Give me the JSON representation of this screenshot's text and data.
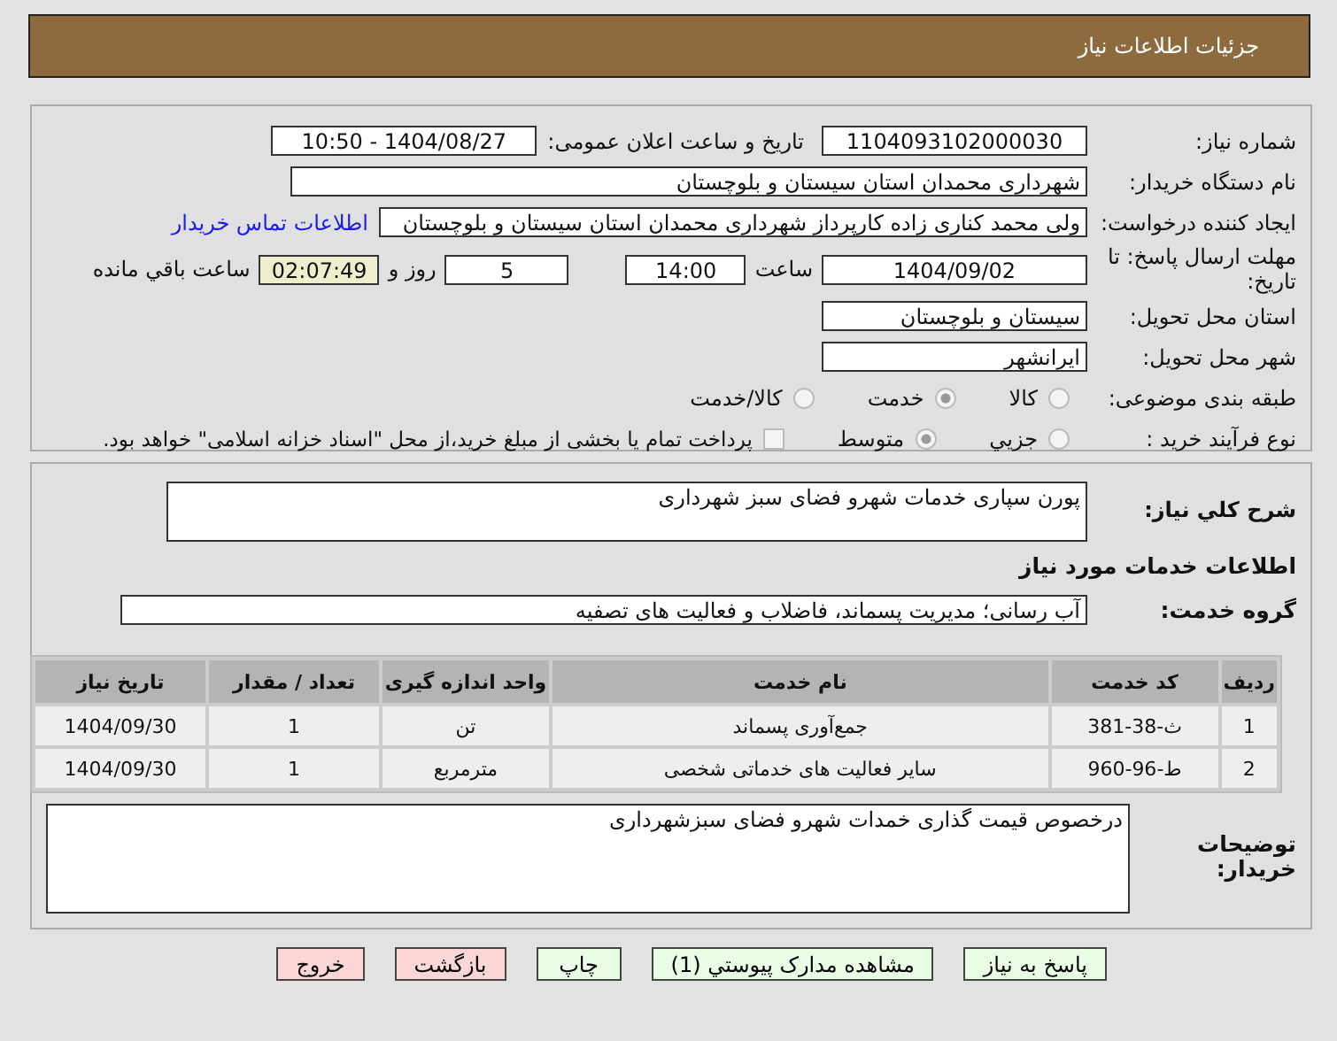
{
  "header": {
    "title": "جزئیات اطلاعات نیاز"
  },
  "need_number": {
    "label": "شماره نیاز:",
    "value": "1104093102000030"
  },
  "announce": {
    "label": "تاریخ و ساعت اعلان عمومی:",
    "value": "1404/08/27 - 10:50"
  },
  "buyer": {
    "label": "نام دستگاه خریدار:",
    "value": "شهرداری محمدان استان سیستان و بلوچستان"
  },
  "creator": {
    "label": "ایجاد کننده درخواست:",
    "value": "ولی محمد کناری زاده کارپرداز شهرداری محمدان استان سیستان و بلوچستان",
    "link": "اطلاعات تماس خریدار"
  },
  "deadline": {
    "label": "مهلت ارسال پاسخ: تا تاریخ:",
    "date": "1404/09/02",
    "time_label": "ساعت",
    "time": "14:00",
    "days": "5",
    "days_label": "روز و",
    "remaining": "02:07:49",
    "remaining_label": "ساعت باقي مانده"
  },
  "province": {
    "label": "استان محل تحویل:",
    "value": "سیستان و بلوچستان"
  },
  "city": {
    "label": "شهر محل تحویل:",
    "value": "ایرانشهر"
  },
  "category": {
    "label": "طبقه بندی موضوعی:",
    "options": [
      {
        "label": "کالا",
        "selected": false
      },
      {
        "label": "خدمت",
        "selected": true
      },
      {
        "label": "کالا/خدمت",
        "selected": false
      }
    ]
  },
  "process": {
    "label": "نوع فرآیند خرید :",
    "options": [
      {
        "label": "جزيي",
        "selected": false
      },
      {
        "label": "متوسط",
        "selected": true
      }
    ],
    "payment": {
      "checked": false,
      "text": "پرداخت تمام یا بخشی از مبلغ خرید،از محل \"اسناد خزانه اسلامی\" خواهد بود."
    }
  },
  "description": {
    "label": "شرح كلي نياز:",
    "value": "پورن سپاری خدمات شهرو فضای سبز شهرداری"
  },
  "services_title": "اطلاعات خدمات مورد نياز",
  "service_group": {
    "label": "گروه خدمت:",
    "value": "آب رسانی؛ مدیریت پسماند، فاضلاب و فعالیت های تصفیه"
  },
  "table": {
    "columns": [
      "ردیف",
      "کد خدمت",
      "نام خدمت",
      "واحد اندازه گیری",
      "تعداد / مقدار",
      "تاریخ نیاز"
    ],
    "rows": [
      [
        "1",
        "ث-38-381",
        "جمع‌آوری پسماند",
        "تن",
        "1",
        "1404/09/30"
      ],
      [
        "2",
        "ط-96-960",
        "سایر فعالیت های خدماتی شخصی",
        "مترمربع",
        "1",
        "1404/09/30"
      ]
    ]
  },
  "notes": {
    "label": "توضیحات خریدار:",
    "value": "درخصوص قیمت گذاری خمدات شهرو فضای سبزشهرداری"
  },
  "buttons": [
    {
      "label": "پاسخ به نیاز",
      "kind": "green"
    },
    {
      "label": "مشاهده مدارک پیوستي (1)",
      "kind": "green"
    },
    {
      "label": "چاپ",
      "kind": "green"
    },
    {
      "label": "بازگشت",
      "kind": "red"
    },
    {
      "label": "خروج",
      "kind": "red"
    }
  ]
}
